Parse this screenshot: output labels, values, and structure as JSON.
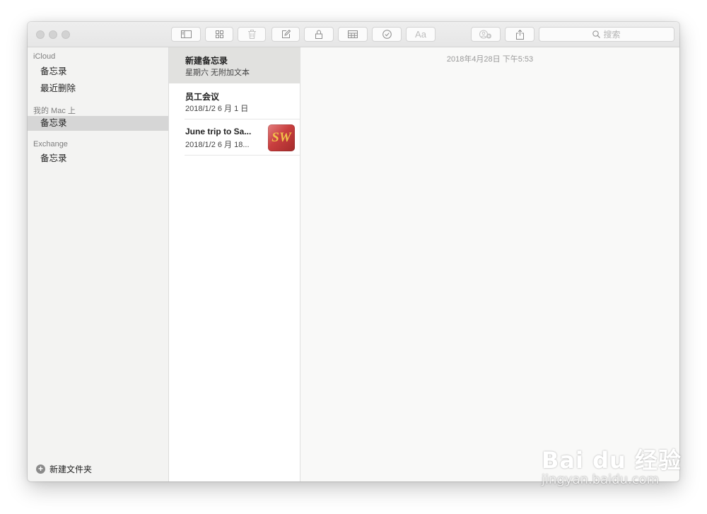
{
  "toolbar": {
    "buttons": [
      {
        "name": "sidebar-toggle-button",
        "icon": "sidebar-icon"
      },
      {
        "name": "attachments-button",
        "icon": "grid-icon"
      },
      {
        "name": "delete-button",
        "icon": "trash-icon"
      },
      {
        "name": "new-note-button",
        "icon": "compose-icon"
      },
      {
        "name": "lock-button",
        "icon": "lock-icon"
      },
      {
        "name": "table-button",
        "icon": "table-icon"
      },
      {
        "name": "checklist-button",
        "icon": "checkmark-circle-icon"
      },
      {
        "name": "format-button",
        "icon": "text-format-icon",
        "label": "Aa"
      },
      {
        "name": "add-people-button",
        "icon": "add-people-icon"
      },
      {
        "name": "share-button",
        "icon": "share-icon"
      }
    ],
    "search_placeholder": "搜索"
  },
  "sidebar": {
    "accounts": [
      {
        "name": "iCloud",
        "folders": [
          "备忘录",
          "最近删除"
        ]
      },
      {
        "name": "我的 Mac 上",
        "folders": [
          "备忘录"
        ]
      },
      {
        "name": "Exchange",
        "folders": [
          "备忘录"
        ]
      }
    ],
    "selected_folder": "我的 Mac 上 / 备忘录",
    "new_folder_label": "新建文件夹"
  },
  "notes": [
    {
      "title": "新建备忘录",
      "subtitle": "星期六  无附加文本",
      "selected": true
    },
    {
      "title": "员工会议",
      "subtitle": "2018/1/2  6 月 1 日",
      "selected": false
    },
    {
      "title": "June trip to Sa...",
      "subtitle": "2018/1/2  6 月 18...",
      "thumbnail_text": "SW",
      "selected": false
    }
  ],
  "editor": {
    "date": "2018年4月28日 下午5:53"
  },
  "watermark": {
    "brand": "Bai du 经验",
    "url": "jingyan.baidu.com"
  },
  "colors": {
    "selected_folder_bg": "#d6d6d6",
    "selected_note_bg": "#e1e1df",
    "thumbnail_red": "#c93f3f",
    "thumbnail_gold": "#f2c24a"
  }
}
